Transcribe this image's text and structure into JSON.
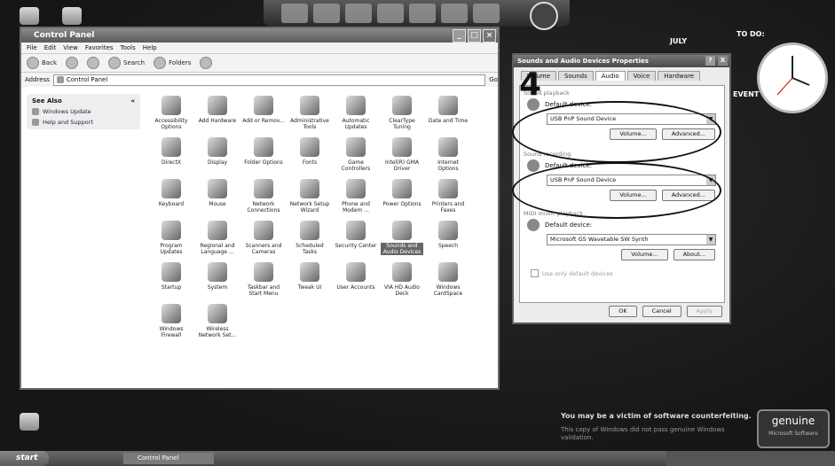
{
  "control_panel": {
    "title": "Control Panel",
    "menu": [
      "File",
      "Edit",
      "View",
      "Favorites",
      "Tools",
      "Help"
    ],
    "toolbar": {
      "back": "Back",
      "search": "Search",
      "folders": "Folders"
    },
    "address_label": "Address",
    "address_value": "Control Panel",
    "go_label": "Go",
    "see_also": "See Also",
    "links": [
      "Windows Update",
      "Help and Support"
    ],
    "items": [
      "Accessibility Options",
      "Add Hardware",
      "Add or Remov...",
      "Administrative Tools",
      "Automatic Updates",
      "ClearType Tuning",
      "Date and Time",
      "DirectX",
      "Display",
      "Folder Options",
      "Fonts",
      "Game Controllers",
      "Intel(R) GMA Driver",
      "Internet Options",
      "Keyboard",
      "Mouse",
      "Network Connections",
      "Network Setup Wizard",
      "Phone and Modem ...",
      "Power Options",
      "Printers and Faxes",
      "Program Updates",
      "Regional and Language ...",
      "Scanners and Cameras",
      "Scheduled Tasks",
      "Security Center",
      "Sounds and Audio Devices",
      "Speech",
      "Startup",
      "System",
      "Taskbar and Start Menu",
      "Tweak UI",
      "User Accounts",
      "VIA HD Audio Deck",
      "Windows CardSpace",
      "Windows Firewall",
      "Wireless Network Set..."
    ],
    "selected_item": "Sounds and Audio Devices"
  },
  "sound_dialog": {
    "title": "Sounds and Audio Devices Properties",
    "help_btn": "?",
    "close_btn": "X",
    "tabs": [
      "Volume",
      "Sounds",
      "Audio",
      "Voice",
      "Hardware"
    ],
    "active_tab": "Audio",
    "playback_head": "Sound playback",
    "playback_default": "Default device:",
    "playback_device": "USB PnP Sound Device",
    "recording_head": "Sound recording",
    "recording_default": "Default device:",
    "recording_device": "USB PnP Sound Device",
    "midi_head": "MIDI music playback",
    "midi_default": "Default device:",
    "midi_device": "Microsoft GS Wavetable SW Synth",
    "volume_btn": "Volume...",
    "advanced_btn": "Advanced...",
    "about_btn": "About...",
    "use_default_only": "Use only default devices",
    "ok": "OK",
    "cancel": "Cancel",
    "apply": "Apply"
  },
  "annotation": {
    "step": "4"
  },
  "gadgets": {
    "month": "JULY",
    "todo": "TO DO:",
    "events": "EVENT"
  },
  "watermark": {
    "line1": "You may be a victim of software counterfeiting.",
    "line2": "This copy of Windows did not pass genuine Windows validation.",
    "badge": "genuine",
    "badge_sub": "Microsoft Software"
  },
  "taskbar": {
    "start": "start",
    "task_cp": "Control Panel"
  }
}
